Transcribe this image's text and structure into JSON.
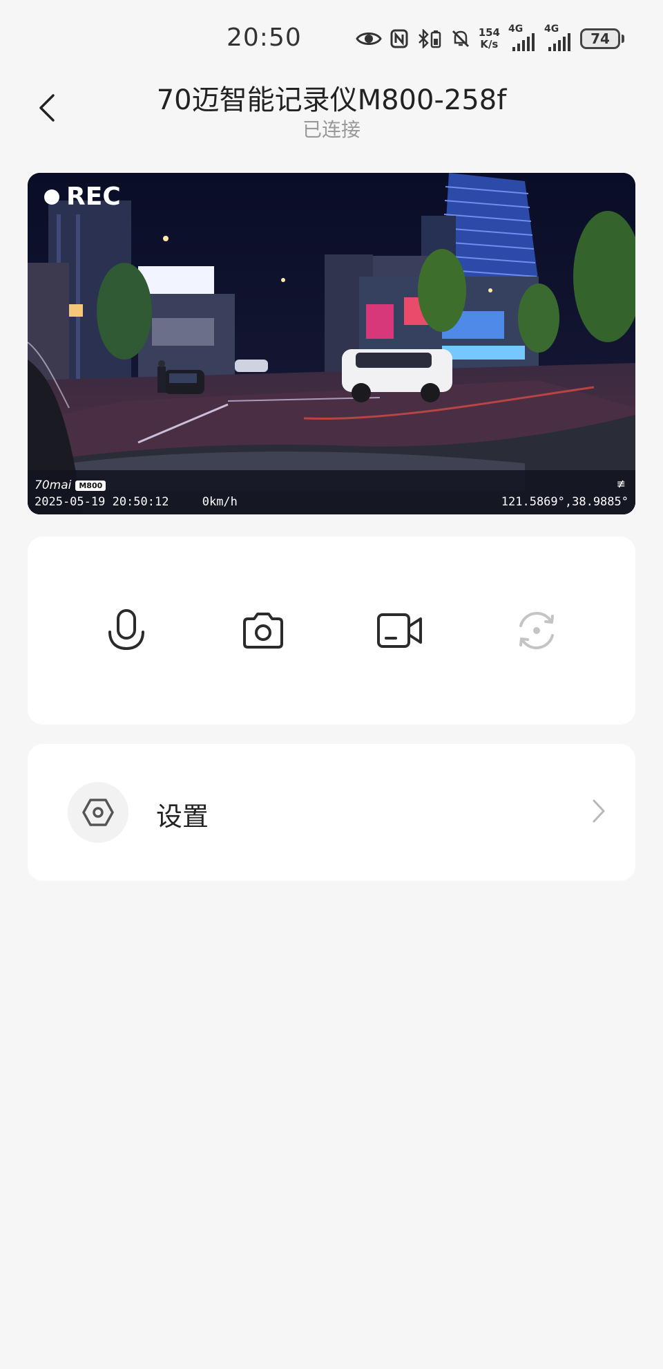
{
  "status_bar": {
    "time": "20:50",
    "speed_value": "154",
    "speed_unit": "K/s",
    "net1": "4G",
    "net2": "4G",
    "battery": "74",
    "icons": [
      "eye-icon",
      "nfc-icon",
      "bluetooth-battery-icon",
      "mute-icon",
      "signal-icon",
      "signal-icon",
      "battery-icon"
    ]
  },
  "header": {
    "title": "70迈智能记录仪M800-258f",
    "subtitle": "已连接"
  },
  "video": {
    "rec_label": "REC",
    "brand": "70mai",
    "model_badge": "M800",
    "datetime": "2025-05-19 20:50:12",
    "speed": "0km/h",
    "coords": "121.5869°,38.9885°",
    "corner_symbol": "≢"
  },
  "controls": {
    "buttons": [
      {
        "name": "microphone",
        "icon": "microphone-icon",
        "enabled": true
      },
      {
        "name": "camera",
        "icon": "camera-icon",
        "enabled": true
      },
      {
        "name": "video-record",
        "icon": "video-camera-icon",
        "enabled": true
      },
      {
        "name": "switch-camera",
        "icon": "switch-camera-icon",
        "enabled": false
      }
    ]
  },
  "settings": {
    "label": "设置",
    "icon": "hexagon-settings-icon"
  },
  "colors": {
    "background": "#f6f6f6",
    "card": "#ffffff",
    "icon_dark": "#2b2b2b",
    "icon_disabled": "#c4c4c4",
    "subtitle": "#999999"
  }
}
